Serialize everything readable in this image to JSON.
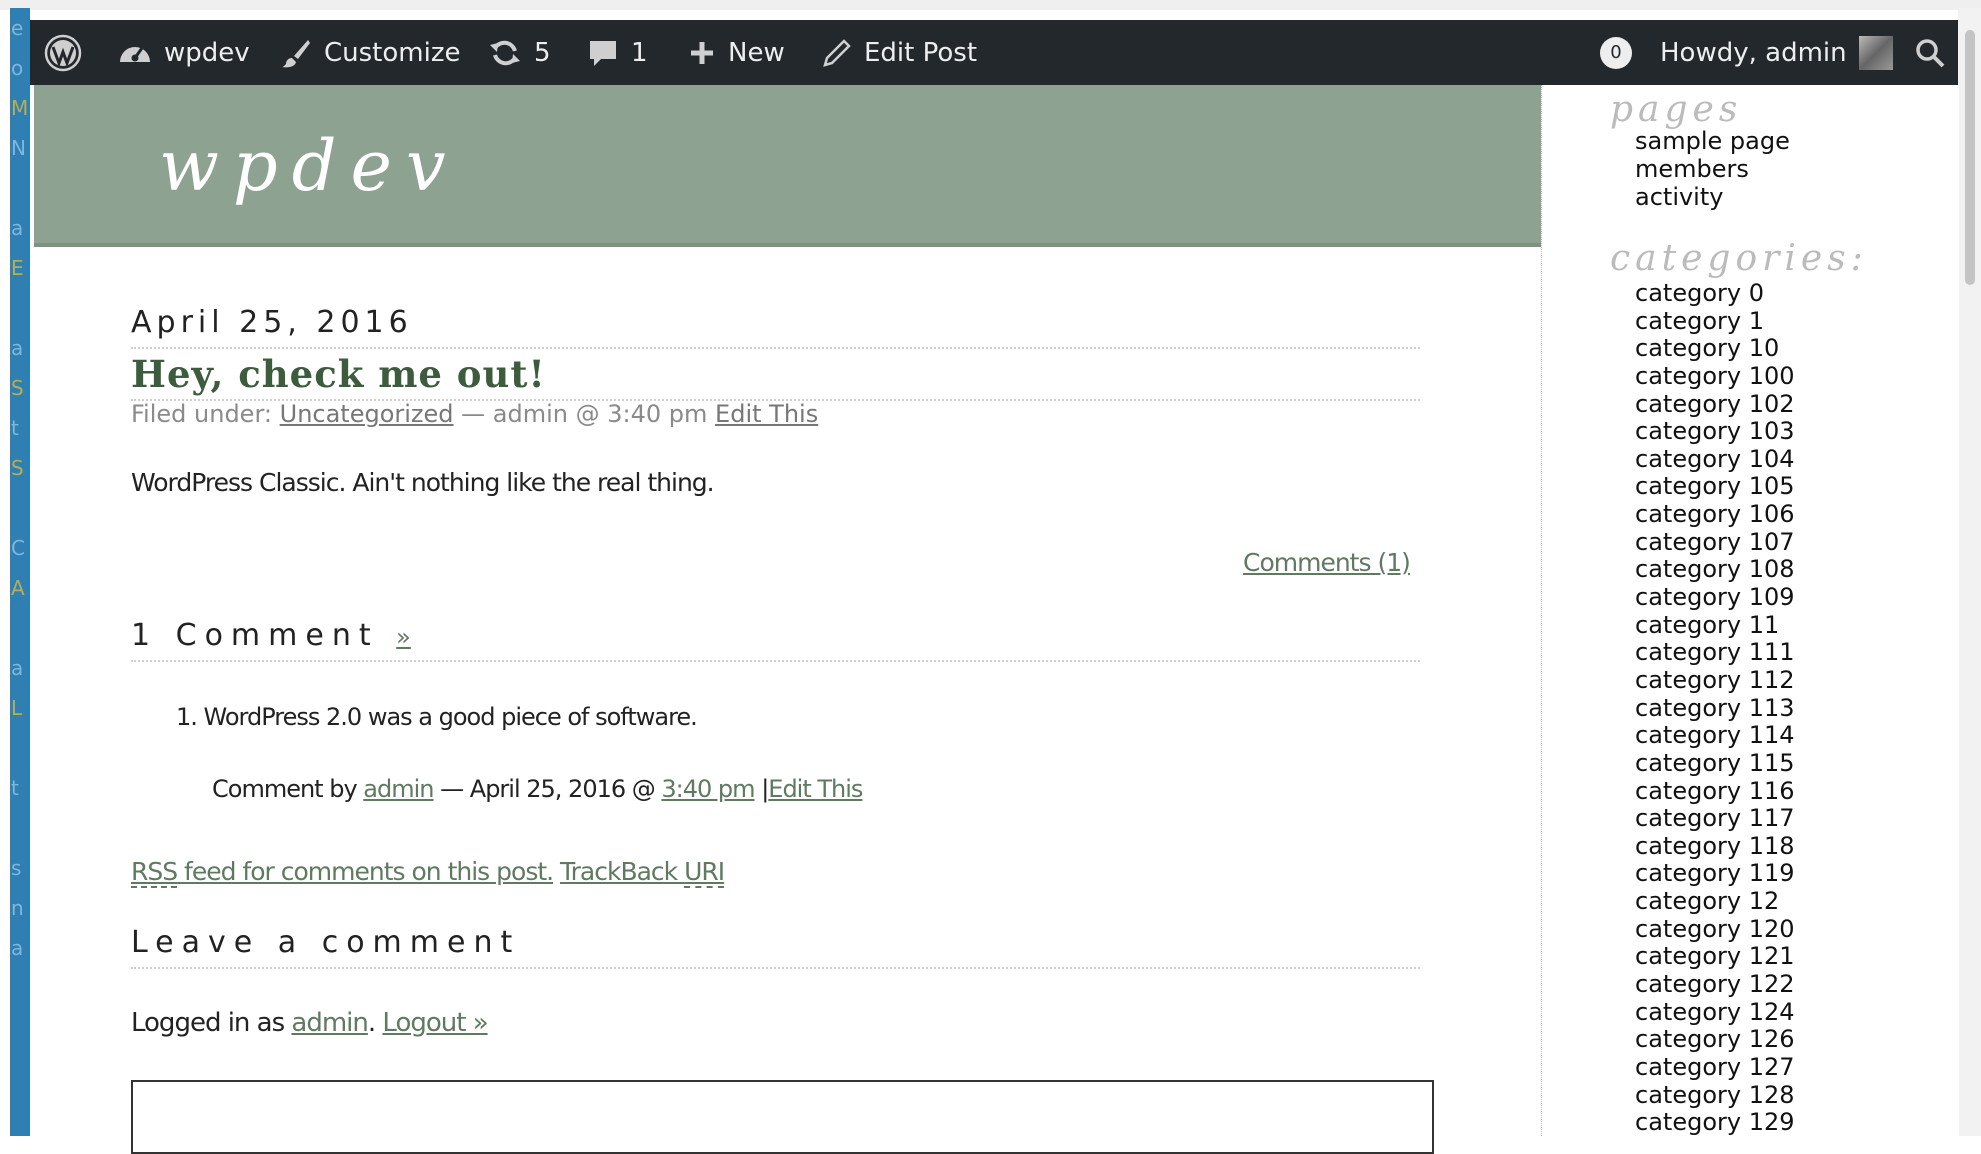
{
  "admin_bar": {
    "site_name": "wpdev",
    "customize": "Customize",
    "updates_count": "5",
    "comments_count": "1",
    "new": "New",
    "edit_post": "Edit Post",
    "notification_count": "0",
    "howdy": "Howdy, admin"
  },
  "site": {
    "title": "wpdev"
  },
  "post": {
    "date": "April 25, 2016",
    "title": "Hey, check me out!",
    "filed_under_label": "Filed under:",
    "category": "Uncategorized",
    "byline": "— admin @ 3:40 pm",
    "edit_this": "Edit This",
    "content": "WordPress Classic. Ain't nothing like the real thing.",
    "comments_link": "Comments (1)"
  },
  "comments": {
    "heading": "1 Comment",
    "heading_link": "»",
    "items": [
      {
        "number": "1.",
        "text": "WordPress 2.0 was a good piece of software.",
        "by_label": "Comment by",
        "author": "admin",
        "date": "— April 25, 2016 @",
        "time": "3:40 pm",
        "separator": "|",
        "edit": "Edit This"
      }
    ],
    "rss_abbr": "RSS",
    "rss_text": " feed for comments on this post.",
    "trackback_text": "TrackBack ",
    "trackback_abbr": "URI"
  },
  "respond": {
    "heading": "Leave a comment",
    "logged_in_as": "Logged in as",
    "user": "admin",
    "dot": ".",
    "logout": "Logout »"
  },
  "sidebar": {
    "pages_heading": "pages",
    "pages": [
      "sample page",
      "members",
      "activity"
    ],
    "categories_heading": "categories:",
    "categories": [
      "category 0",
      "category 1",
      "category 10",
      "category 100",
      "category 102",
      "category 103",
      "category 104",
      "category 105",
      "category 106",
      "category 107",
      "category 108",
      "category 109",
      "category 11",
      "category 111",
      "category 112",
      "category 113",
      "category 114",
      "category 115",
      "category 116",
      "category 117",
      "category 118",
      "category 119",
      "category 12",
      "category 120",
      "category 121",
      "category 122",
      "category 124",
      "category 126",
      "category 127",
      "category 128",
      "category 129"
    ]
  },
  "colors": {
    "admin_bar_bg": "#23282d",
    "header_bg": "#8ea291",
    "link": "#5f7a60",
    "title": "#3d5c3e"
  }
}
